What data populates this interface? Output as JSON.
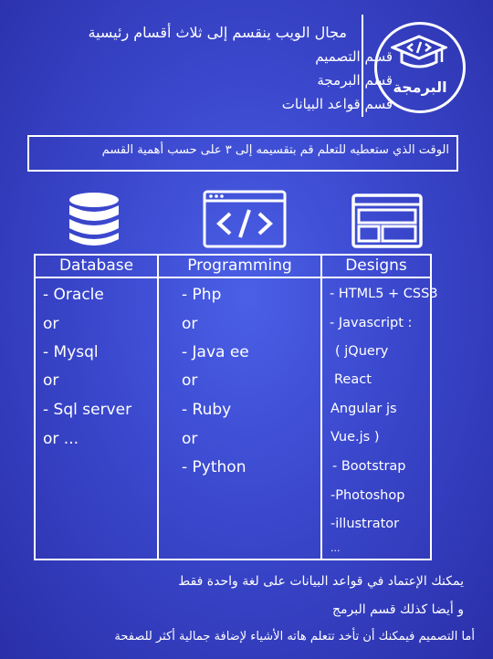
{
  "header": {
    "logo_text": "البرمجة",
    "lines": [
      "مجال الويب ينقسم إلى ثلاث أقسام رئيسية",
      "قسم التصميم",
      "قسم البرمجة",
      "قسم قواعد البيانات"
    ]
  },
  "banner": {
    "text": "الوقت الذي ستعطيه للتعلم قم بتقسيمه إلى ٣ على حسب أهمية القسم"
  },
  "icons": {
    "database": "database-icon",
    "code": "code-window-icon",
    "design": "layout-icon"
  },
  "table": {
    "headers": [
      "Database",
      "Programming",
      "Designs"
    ],
    "database": [
      "- Oracle",
      "or",
      "- Mysql",
      "or",
      "- Sql server",
      "or ..."
    ],
    "programming": [
      "- Php",
      "or",
      "- Java ee",
      "or",
      "- Ruby",
      "or",
      "- Python"
    ],
    "designs": [
      "- HTML5 + CSS3",
      "- Javascript :",
      "( jQuery",
      "React",
      "Angular js",
      "Vue.js )",
      " - Bootstrap",
      "-Photoshop",
      "-illustrator",
      "..."
    ]
  },
  "footer": {
    "lines": [
      "يمكنك الإعتماد في قواعد البيانات على لغة واحدة فقط",
      "و أيضا كذلك قسم البرمج",
      "أما التصميم فيمكنك أن تأخد تتعلم هاته الأشياء لإضافة جمالية أكثر للصفحة"
    ]
  },
  "colors": {
    "background": "#3a47cc",
    "foreground": "#ffffff"
  }
}
